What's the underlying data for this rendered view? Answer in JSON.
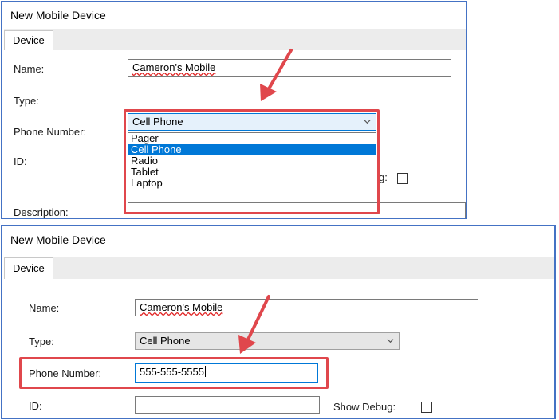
{
  "panel1": {
    "title": "New Mobile Device",
    "tab": "Device",
    "name_label": "Name:",
    "name_value": "Cameron's Mobile",
    "type_label": "Type:",
    "type_value": "Cell Phone",
    "phone_label": "Phone Number:",
    "id_label": "ID:",
    "description_label": "Description:",
    "partial_debug_label": "g:",
    "type_options": [
      "Pager",
      "Cell Phone",
      "Radio",
      "Tablet",
      "Laptop"
    ]
  },
  "panel2": {
    "title": "New Mobile Device",
    "tab": "Device",
    "name_label": "Name:",
    "name_value": "Cameron's Mobile",
    "type_label": "Type:",
    "type_value": "Cell Phone",
    "phone_label": "Phone Number:",
    "phone_value": "555-555-5555",
    "id_label": "ID:",
    "show_debug_label": "Show Debug:"
  },
  "colors": {
    "border_accent": "#4472c4",
    "highlight": "#e0474c",
    "selection": "#0078d7"
  }
}
